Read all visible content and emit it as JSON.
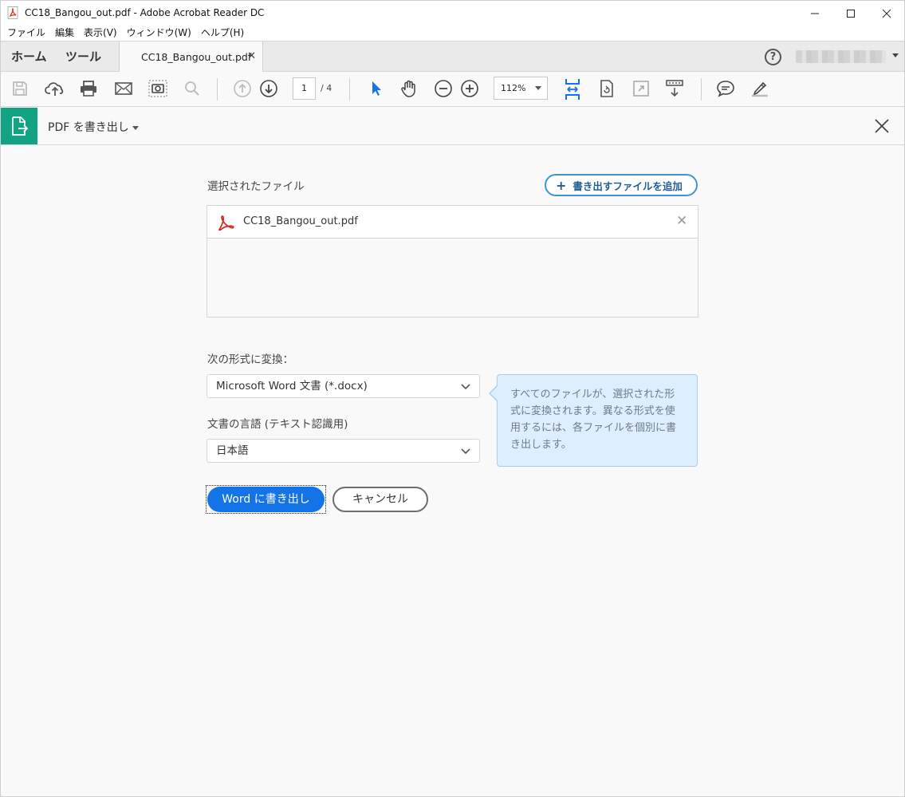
{
  "window": {
    "title": "CC18_Bangou_out.pdf - Adobe Acrobat Reader DC"
  },
  "menu": [
    "ファイル",
    "編集",
    "表示(V)",
    "ウィンドウ(W)",
    "ヘルプ(H)"
  ],
  "tabs": {
    "home": "ホーム",
    "tools": "ツール",
    "document": "CC18_Bangou_out.pdf",
    "help": "?"
  },
  "toolbar": {
    "page_current": "1",
    "page_total": "/ 4",
    "zoom": "112%"
  },
  "tool_panel": {
    "title": "PDF を書き出し"
  },
  "export": {
    "selected_files_label": "選択されたファイル",
    "add_files_button": "書き出すファイルを追加",
    "files": [
      "CC18_Bangou_out.pdf"
    ],
    "convert_to_label": "次の形式に変換：",
    "format_value": "Microsoft Word 文書 (*.docx)",
    "language_label": "文書の言語 (テキスト認識用)",
    "language_value": "日本語",
    "info_text": "すべてのファイルが、選択された形式に変換されます。異なる形式を使用するには、各ファイルを個別に書き出します。",
    "export_button": "Word に書き出し",
    "cancel_button": "キャンセル"
  },
  "colors": {
    "accent_green": "#12a383",
    "primary_blue": "#1473e6",
    "link_blue": "#1f5f98",
    "callout_bg": "#ddeefc"
  }
}
